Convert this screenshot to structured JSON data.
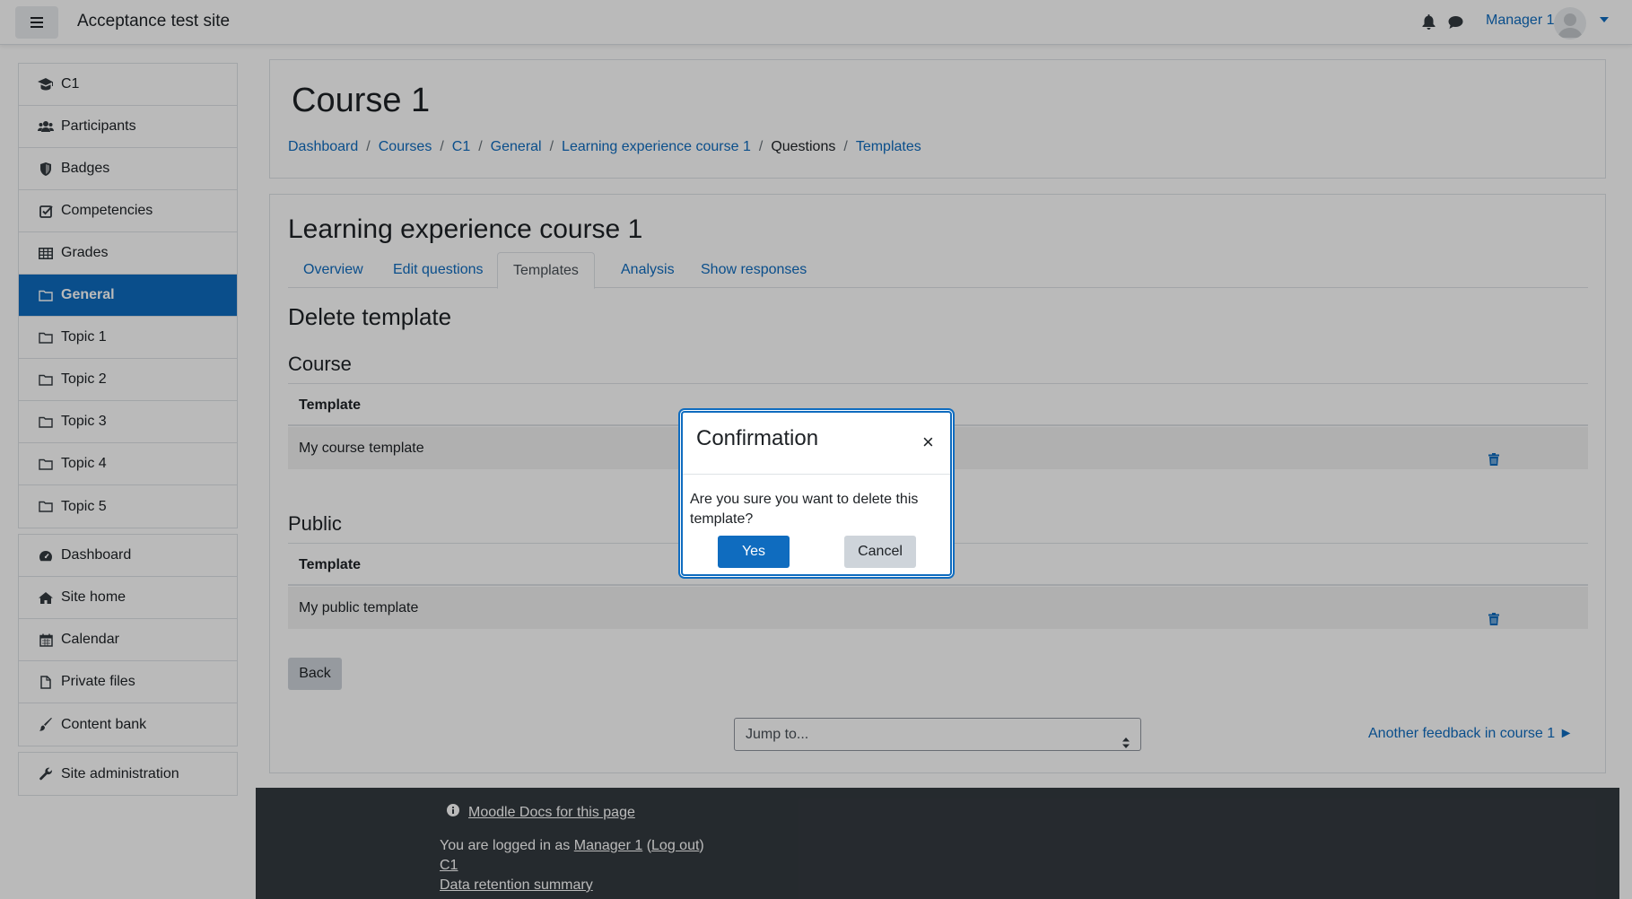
{
  "navbar": {
    "site_name": "Acceptance test site",
    "user_name": "Manager 1"
  },
  "sidebar": {
    "course_items": [
      {
        "label": "C1",
        "icon": "graduation-cap-icon"
      },
      {
        "label": "Participants",
        "icon": "users-icon"
      },
      {
        "label": "Badges",
        "icon": "shield-icon"
      },
      {
        "label": "Competencies",
        "icon": "check-square-icon"
      },
      {
        "label": "Grades",
        "icon": "table-icon"
      },
      {
        "label": "General",
        "icon": "folder-icon",
        "active": true
      },
      {
        "label": "Topic 1",
        "icon": "folder-icon"
      },
      {
        "label": "Topic 2",
        "icon": "folder-icon"
      },
      {
        "label": "Topic 3",
        "icon": "folder-icon"
      },
      {
        "label": "Topic 4",
        "icon": "folder-icon"
      },
      {
        "label": "Topic 5",
        "icon": "folder-icon"
      }
    ],
    "site_items": [
      {
        "label": "Dashboard",
        "icon": "tachometer-icon"
      },
      {
        "label": "Site home",
        "icon": "home-icon"
      },
      {
        "label": "Calendar",
        "icon": "calendar-icon"
      },
      {
        "label": "Private files",
        "icon": "file-icon"
      },
      {
        "label": "Content bank",
        "icon": "paint-brush-icon"
      }
    ],
    "admin_items": [
      {
        "label": "Site administration",
        "icon": "wrench-icon"
      }
    ]
  },
  "header": {
    "title": "Course 1",
    "breadcrumb": [
      "Dashboard",
      "Courses",
      "C1",
      "General",
      "Learning experience course 1",
      "Questions",
      "Templates"
    ]
  },
  "main": {
    "activity_title": "Learning experience course 1",
    "tabs": [
      "Overview",
      "Edit questions",
      "Templates",
      "Analysis",
      "Show responses"
    ],
    "active_tab": "Templates",
    "heading": "Delete template",
    "course_section": {
      "title": "Course",
      "column": "Template",
      "rows": [
        "My course template"
      ]
    },
    "public_section": {
      "title": "Public",
      "column": "Template",
      "rows": [
        "My public template"
      ]
    },
    "back_label": "Back",
    "jump_to": "Jump to...",
    "next_link": "Another feedback in course 1 ►"
  },
  "footer": {
    "docs_link": "Moodle Docs for this page",
    "logged_in_prefix": "You are logged in as ",
    "user_link": "Manager 1",
    "logout_link": "Log out",
    "course_link": "C1",
    "data_retention": "Data retention summary"
  },
  "modal": {
    "title": "Confirmation",
    "close": "×",
    "body": "Are you sure you want to delete this template?",
    "yes_label": "Yes",
    "cancel_label": "Cancel"
  },
  "colors": {
    "primary": "#0f6cbf",
    "footer": "#343a40",
    "secondary_button": "#ced4da"
  }
}
